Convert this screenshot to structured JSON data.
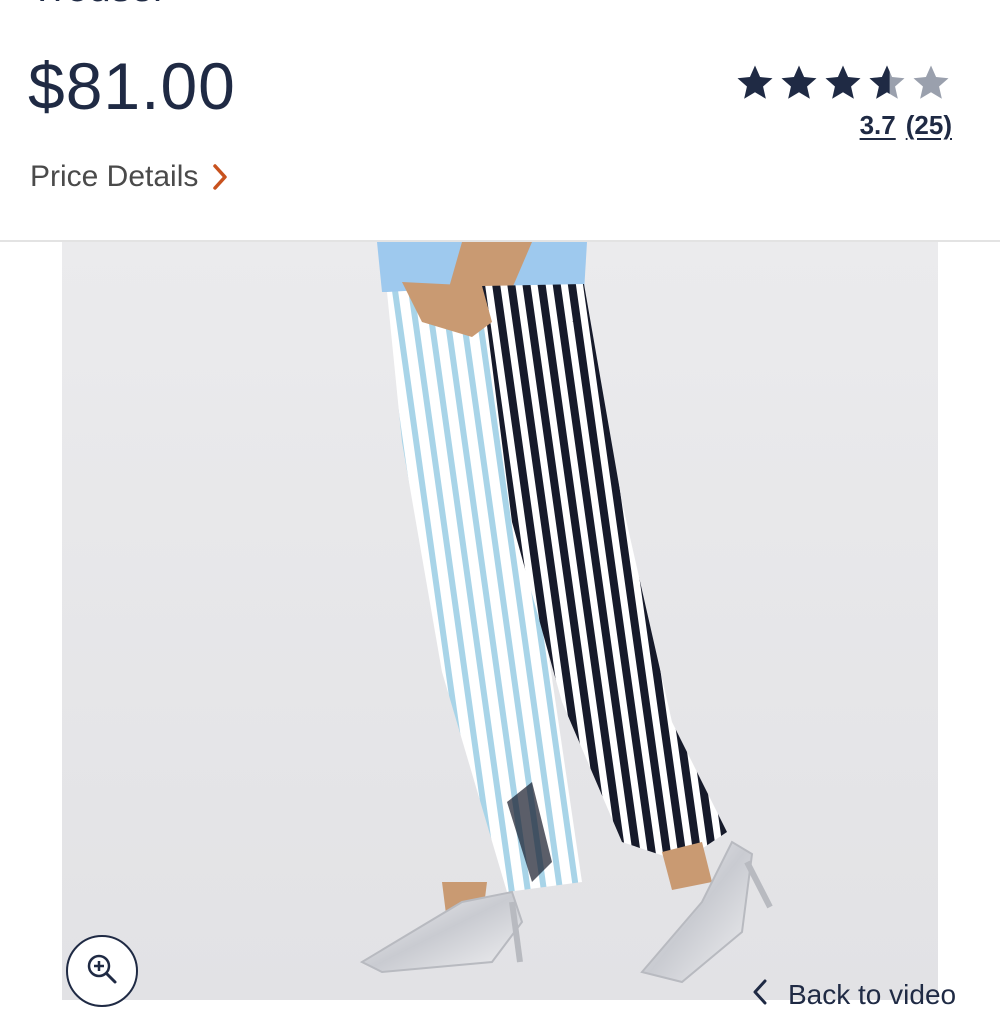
{
  "product": {
    "title_partial": "Trouser",
    "price": "$81.00",
    "price_details_label": "Price Details"
  },
  "rating": {
    "value": "3.7",
    "count": "(25)",
    "stars_filled": 3.7,
    "stars_total": 5
  },
  "media": {
    "image_description_icon": "zoom-icon",
    "back_to_video_label": "Back to video"
  },
  "colors": {
    "text_primary": "#1f2a44",
    "accent_chevron": "#c8521e",
    "star_filled": "#1f2a44",
    "star_empty": "#9aa0ad"
  }
}
